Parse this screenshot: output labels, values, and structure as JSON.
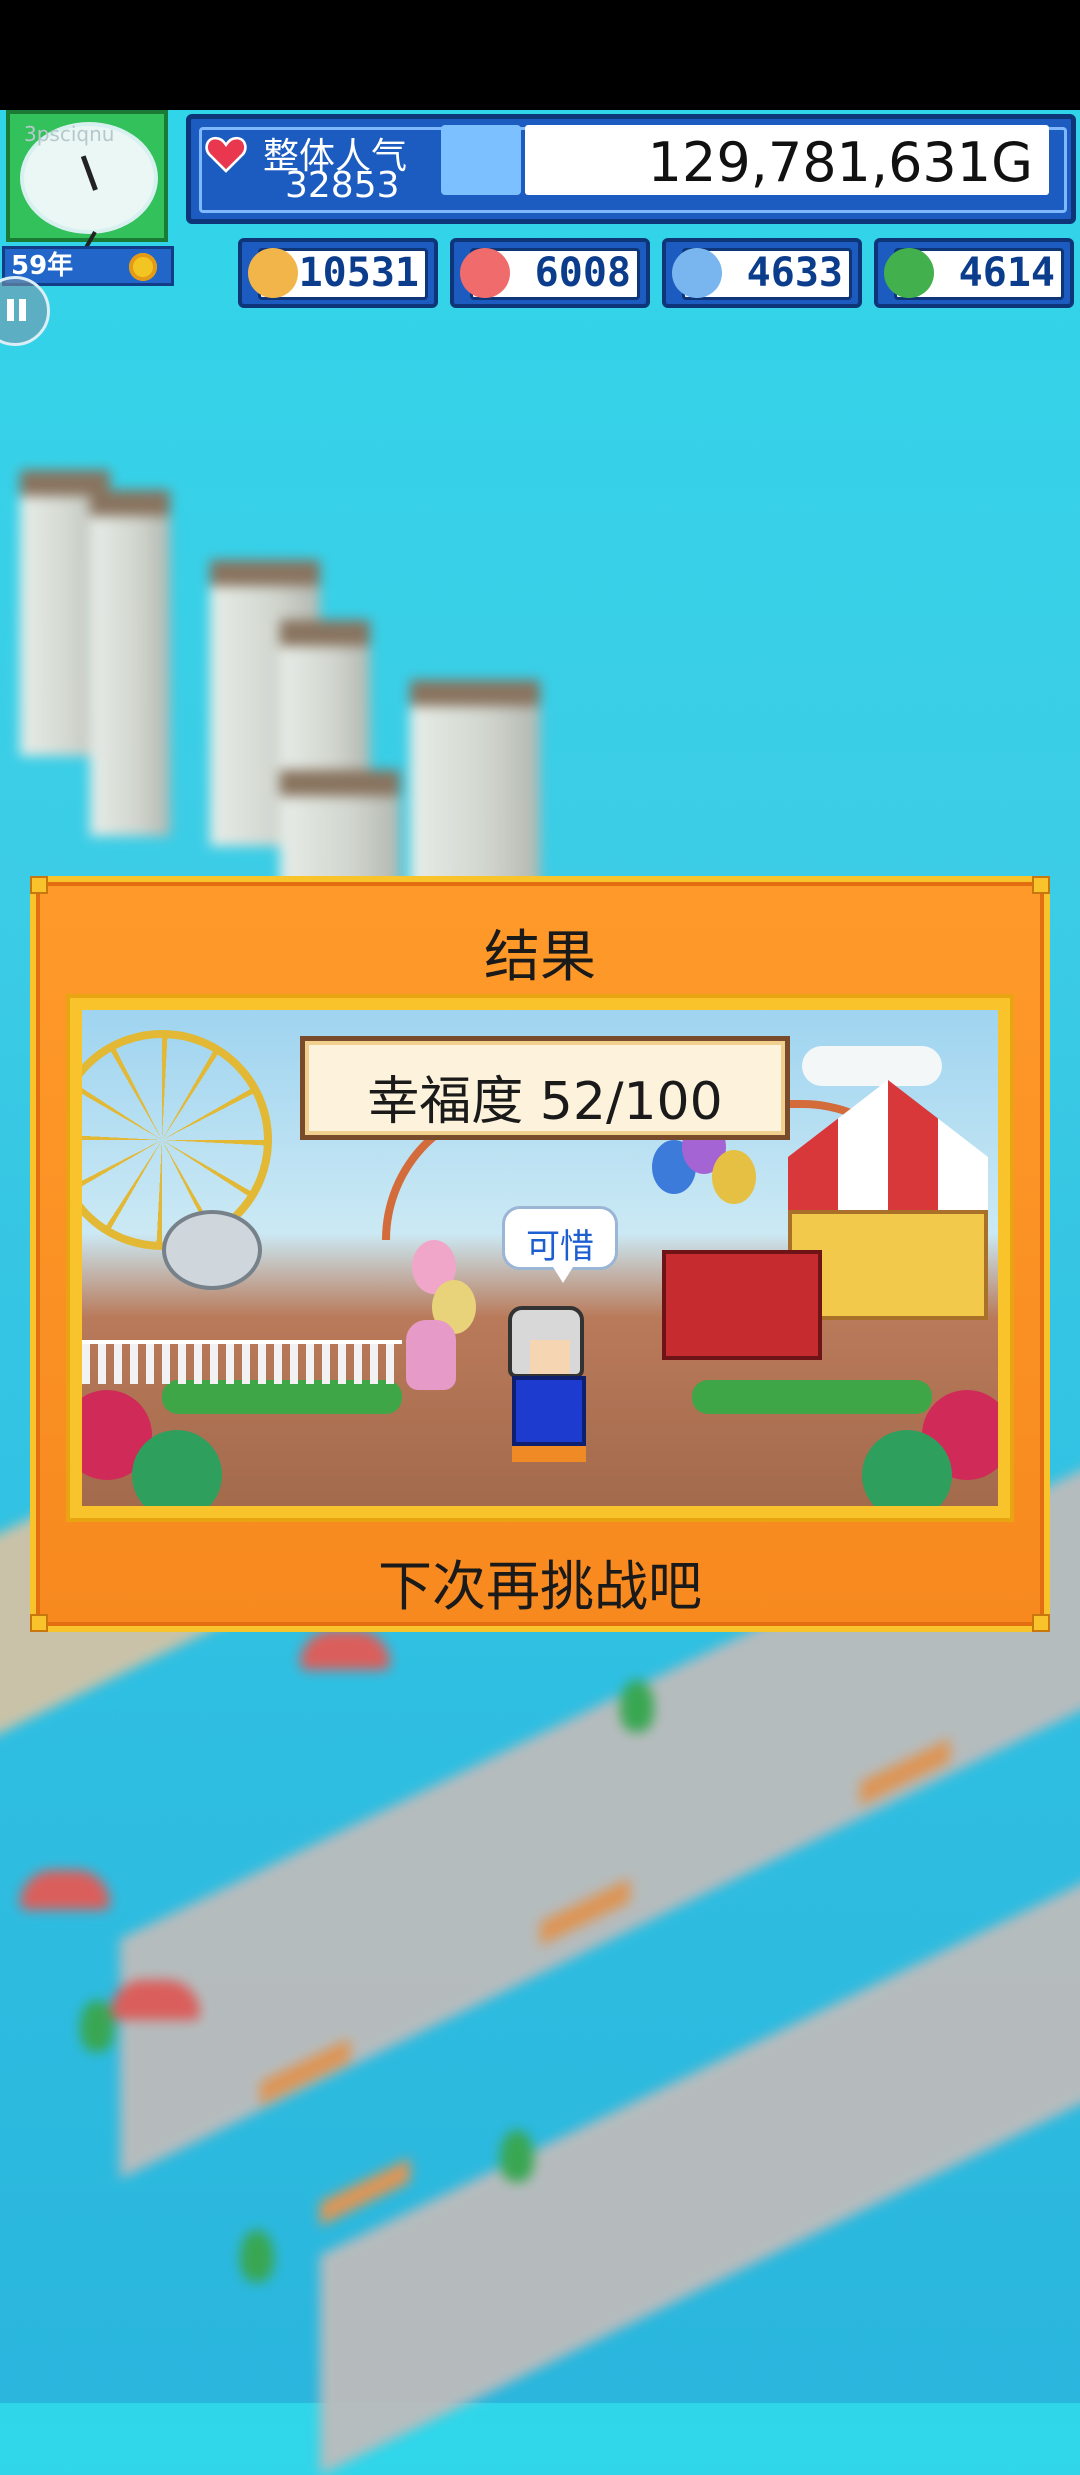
{
  "hud": {
    "clock_label": "3psciqnu",
    "year": "59年",
    "popularity_label": "整体人气",
    "popularity_value": "32853",
    "money": "129,781,631G",
    "stats": [
      "10531",
      "6008",
      "4633",
      "4614"
    ]
  },
  "dialog": {
    "title": "结果",
    "score": "幸福度 52/100",
    "speech": "可惜",
    "subtitle": "下次再挑战吧"
  },
  "colors": {
    "dialog_orange": "#f7891f",
    "dialog_border": "#f8c32b",
    "hud_blue": "#1c5bbf"
  },
  "icons": [
    "clock-icon",
    "sun-icon",
    "heart-icon",
    "money-icon",
    "pause-icon"
  ]
}
